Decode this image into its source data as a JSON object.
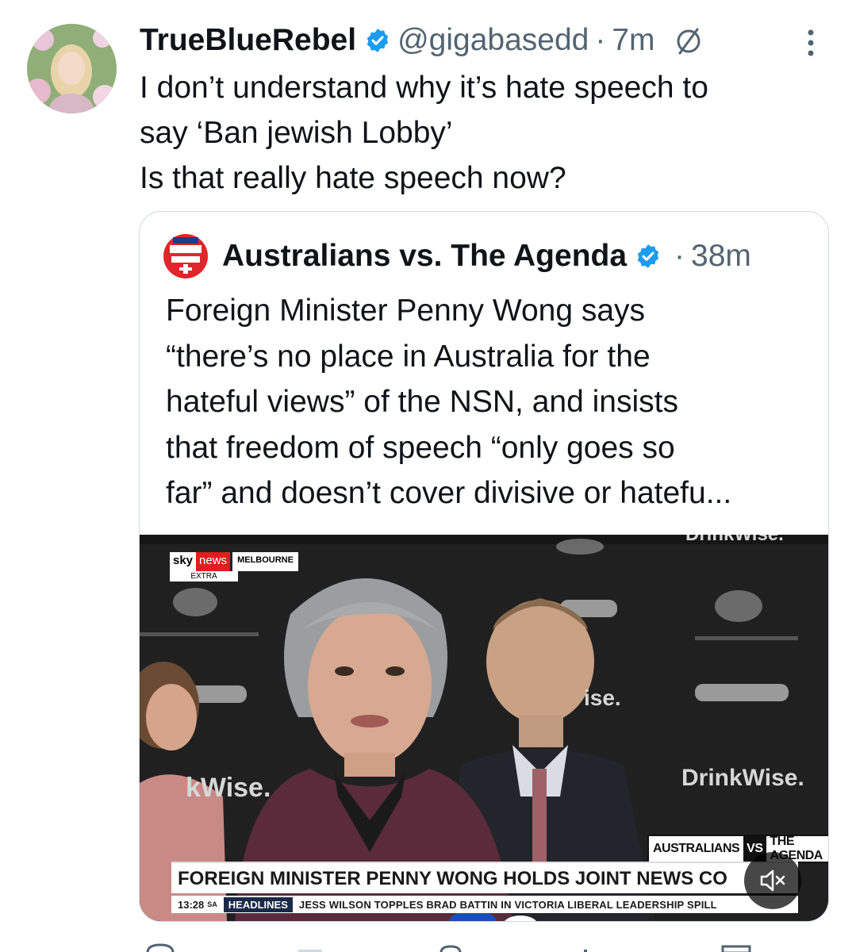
{
  "tweet": {
    "display_name": "TrueBlueRebel",
    "handle": "@gigabasedd",
    "separator": "·",
    "time": "7m",
    "lines": [
      "I don’t understand why it’s hate speech to",
      "say ‘Ban jewish Lobby’",
      "Is that really hate speech now?"
    ]
  },
  "quote": {
    "display_name": "Australians vs. The Agenda",
    "separator": "·",
    "time": "38m",
    "lines": [
      "Foreign Minister Penny Wong says",
      "“there’s no place in Australia for the",
      "hateful views” of the NSN, and insists",
      "that freedom of speech “only goes so",
      "far” and doesn’t cover divisive or hatefu..."
    ],
    "media": {
      "channel_sky": "sky",
      "channel_news": "news",
      "channel_city": "MELBOURNE",
      "channel_extra": "EXTRA",
      "bg_words": [
        "kWise.",
        "DrinkWise.",
        "ise.",
        "DrinkWise."
      ],
      "watermark": [
        "AUSTRALIANS",
        "VS",
        "THE AGENDA"
      ],
      "lower_third": "FOREIGN MINISTER PENNY WONG HOLDS JOINT NEWS CO",
      "ticker_time": "13:28",
      "ticker_tz": "SA",
      "ticker_tag": "HEADLINES",
      "ticker_text": "JESS WILSON TOPPLES BRAD BATTIN IN VICTORIA LIBERAL LEADERSHIP SPILL"
    }
  },
  "colors": {
    "verified": "#1d9bf0",
    "secondary_text": "#536471",
    "border": "#cfd9de",
    "news_red": "#e31c23"
  },
  "icons": [
    "verified-badge-icon",
    "mute-conversation-icon",
    "more-options-icon",
    "mute-video-icon"
  ]
}
